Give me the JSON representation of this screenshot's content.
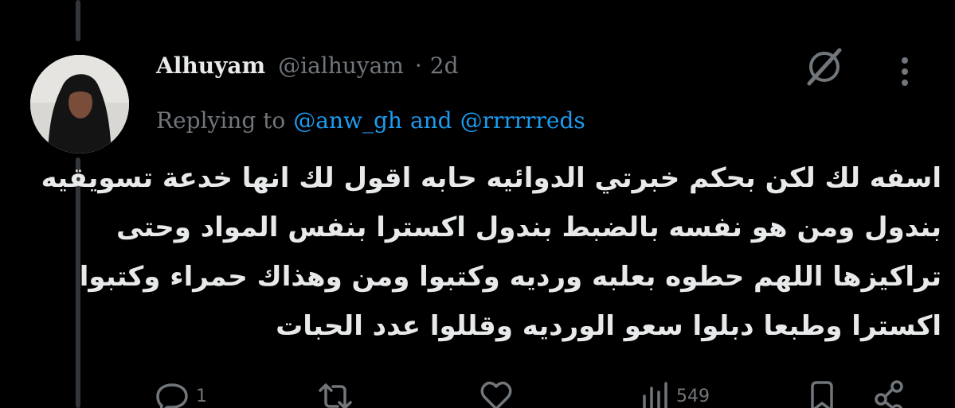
{
  "tweet": {
    "author_name": "Alhuyam",
    "author_handle": "@ialhuyam",
    "separator": "·",
    "time": "2d",
    "replying_label": "Replying to",
    "reply_mention_1": "@anw_gh",
    "reply_conjunction": "and",
    "reply_mention_2": "@rrrrrreds",
    "body_lines": [
      "اسفه لك لكن بحكم خبرتي الدوائيه حابه اقول لك انها خدعة تسويقيه",
      "بندول ومن هو نفسه بالضبط بندول اكسترا بنفس المواد وحتى",
      "تراكيزها اللهم حطوه بعلبه ورديه وكتبوا ومن وهذاك حمراء وكتبوا",
      "اكسترا وطبعا دبلوا سعو الورديه وقللوا عدد الحبات"
    ]
  },
  "actions": {
    "reply_count": "1",
    "views_count": "549"
  },
  "icons": {
    "grok": "grok-icon",
    "more": "more-vertical-icon",
    "reply": "reply-icon",
    "retweet": "retweet-icon",
    "like": "heart-icon",
    "views": "views-icon",
    "bookmark": "bookmark-icon",
    "share": "share-icon"
  },
  "colors": {
    "background": "#000000",
    "text": "#e7e9ea",
    "muted": "#71767b",
    "link": "#1d9bf0",
    "thread_line": "#333639"
  }
}
